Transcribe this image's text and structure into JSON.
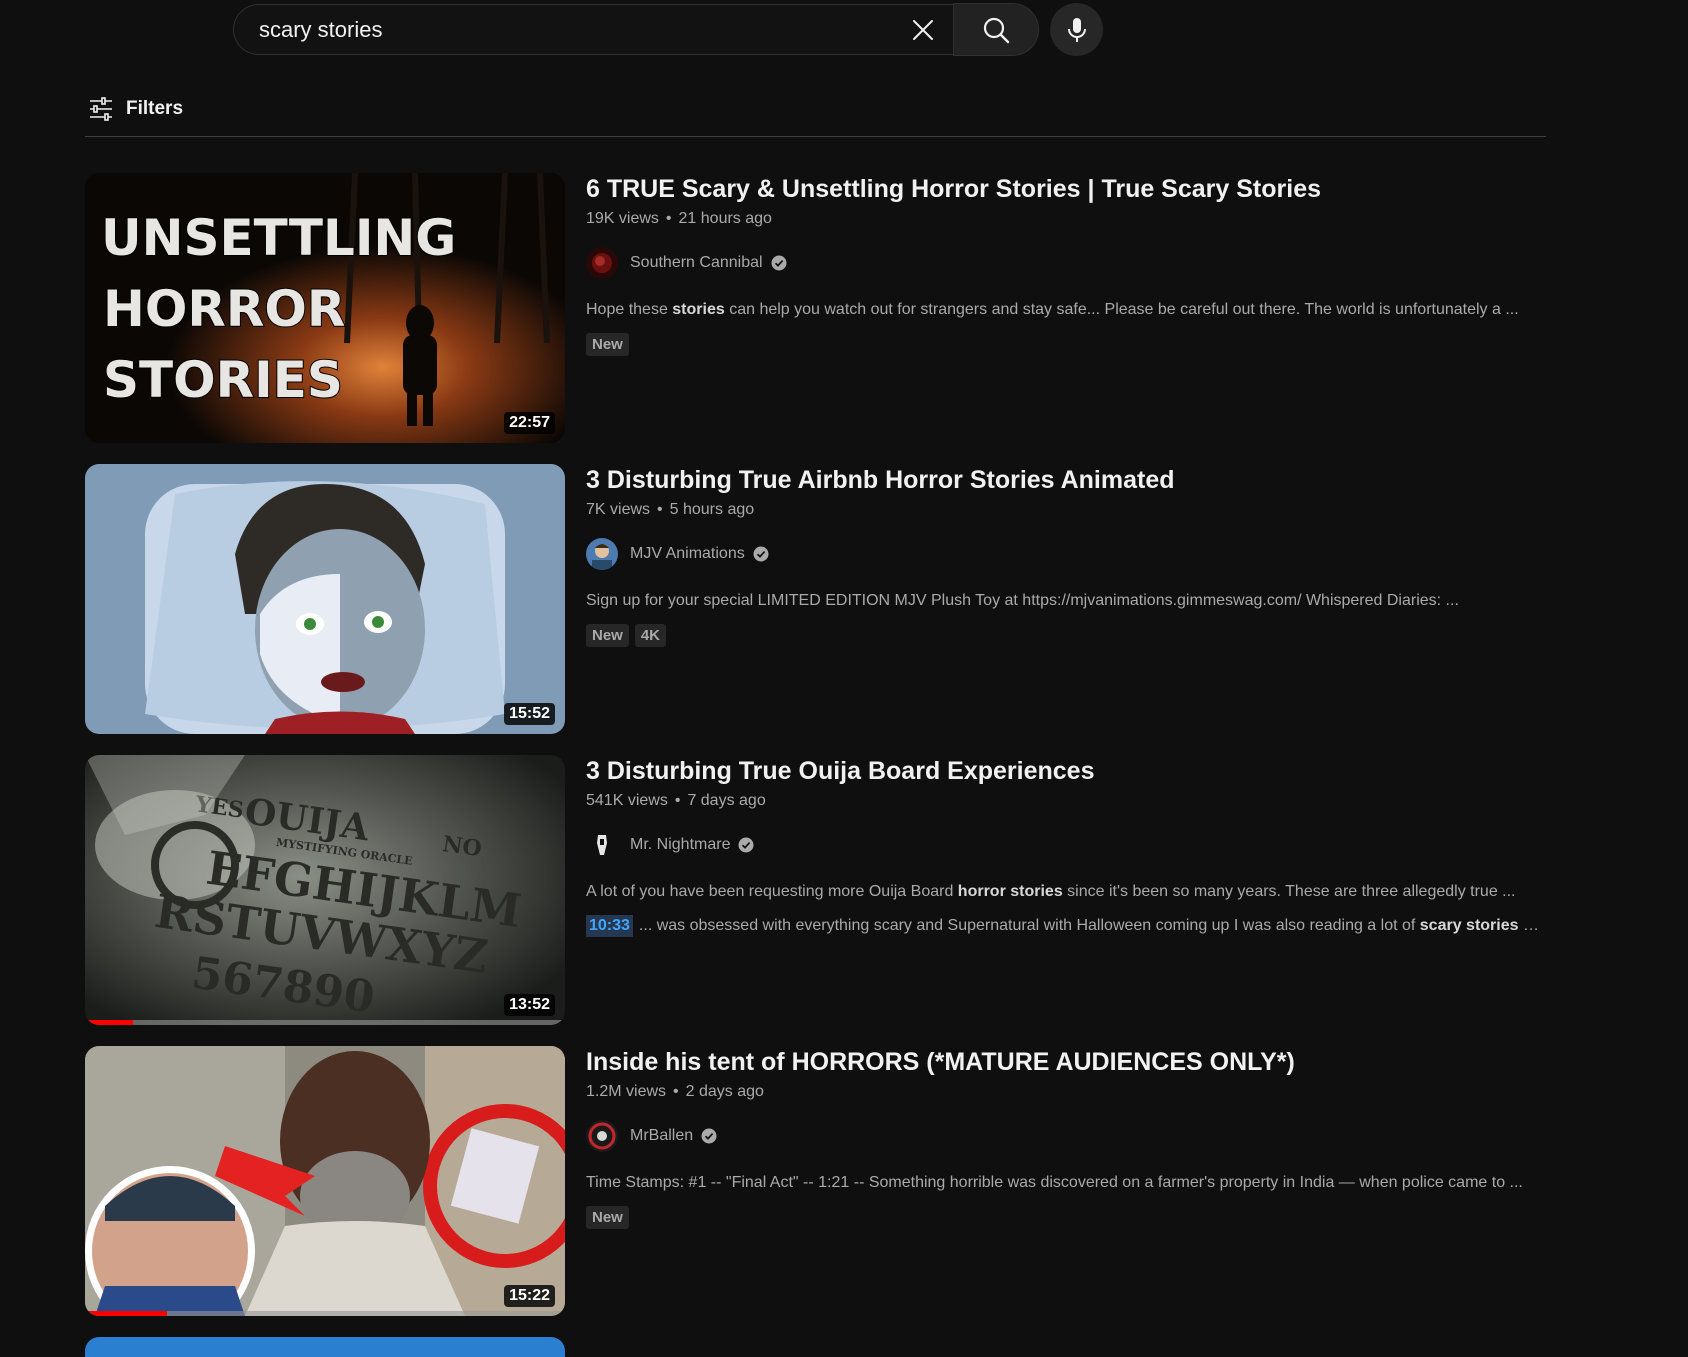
{
  "search": {
    "query": "scary stories"
  },
  "filters": {
    "label": "Filters"
  },
  "colors": {
    "background": "#0f0f0f",
    "text": "#f1f1f1",
    "muted": "#aaaaaa",
    "progress": "#ff0000",
    "timestamp": "#3ea6ff"
  },
  "results": [
    {
      "title": "6 TRUE Scary & Unsettling Horror Stories | True Scary Stories",
      "views": "19K views",
      "age": "21 hours ago",
      "channel": "Southern Cannibal",
      "desc_pre": "Hope these ",
      "desc_bold": "stories",
      "desc_post": " can help you watch out for strangers and stay safe... Please be careful out there. The world is unfortunately a ...",
      "badges": [
        "New"
      ],
      "duration": "22:57",
      "thumb_text": [
        "UNSETTLING",
        "HORROR",
        "STORIES"
      ]
    },
    {
      "title": "3 Disturbing True Airbnb Horror Stories Animated",
      "views": "7K views",
      "age": "5 hours ago",
      "channel": "MJV Animations",
      "desc": "Sign up for your special LIMITED EDITION MJV Plush Toy at https://mjvanimations.gimmeswag.com/ Whispered Diaries: ...",
      "badges": [
        "New",
        "4K"
      ],
      "duration": "15:52"
    },
    {
      "title": "3 Disturbing True Ouija Board Experiences",
      "views": "541K views",
      "age": "7 days ago",
      "channel": "Mr. Nightmare",
      "desc_pre": "A lot of you have been requesting more Ouija Board ",
      "desc_bold": "horror stories",
      "desc_post": " since it's been so many years. These are three allegedly true ...",
      "moment_time": "10:33",
      "moment_pre": "... was obsessed with everything scary and Supernatural with Halloween coming up I was also reading a lot of ",
      "moment_bold": "scary stories ab",
      "moment_post": "...",
      "duration": "13:52",
      "progress": 0.1,
      "thumb_text": [
        "YES",
        "OUIJA",
        "NO",
        "MYSTIFYING ORACLE",
        "EFGHIJKLM",
        "RSTUVWXYZ",
        "567890"
      ]
    },
    {
      "title": "Inside his tent of HORRORS (*MATURE AUDIENCES ONLY*)",
      "views": "1.2M views",
      "age": "2 days ago",
      "channel": "MrBallen",
      "desc": "Time Stamps: #1 -- \"Final Act\" -- 1:21 -- Something horrible was discovered on a farmer's property in India — when police came to ...",
      "badges": [
        "New"
      ],
      "duration": "15:22",
      "progress": 0.17
    }
  ]
}
